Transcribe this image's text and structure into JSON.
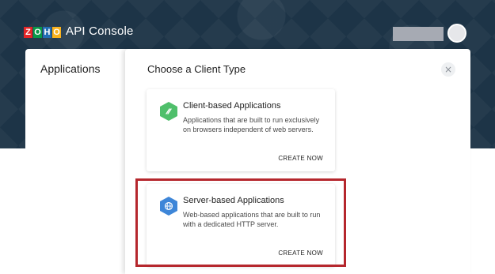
{
  "header": {
    "brand_letters": [
      "Z",
      "O",
      "H",
      "O"
    ],
    "brand_colors": [
      "#e42527",
      "#089949",
      "#226db4",
      "#f9b21d"
    ],
    "app_title": "API Console"
  },
  "sidebar": {
    "title": "Applications"
  },
  "modal": {
    "title": "Choose a Client Type",
    "close_glyph": "×",
    "cards": [
      {
        "title": "Client-based Applications",
        "description": "Applications that are built to run exclusively on browsers independent of web servers.",
        "cta": "CREATE NOW",
        "icon": "client-icon",
        "icon_color": "#4fbf6b"
      },
      {
        "title": "Server-based Applications",
        "description": "Web-based applications that are built to run with a dedicated HTTP server.",
        "cta": "CREATE NOW",
        "icon": "globe-icon",
        "icon_color": "#3e86d8"
      }
    ]
  },
  "highlight_color": "#b5272d"
}
